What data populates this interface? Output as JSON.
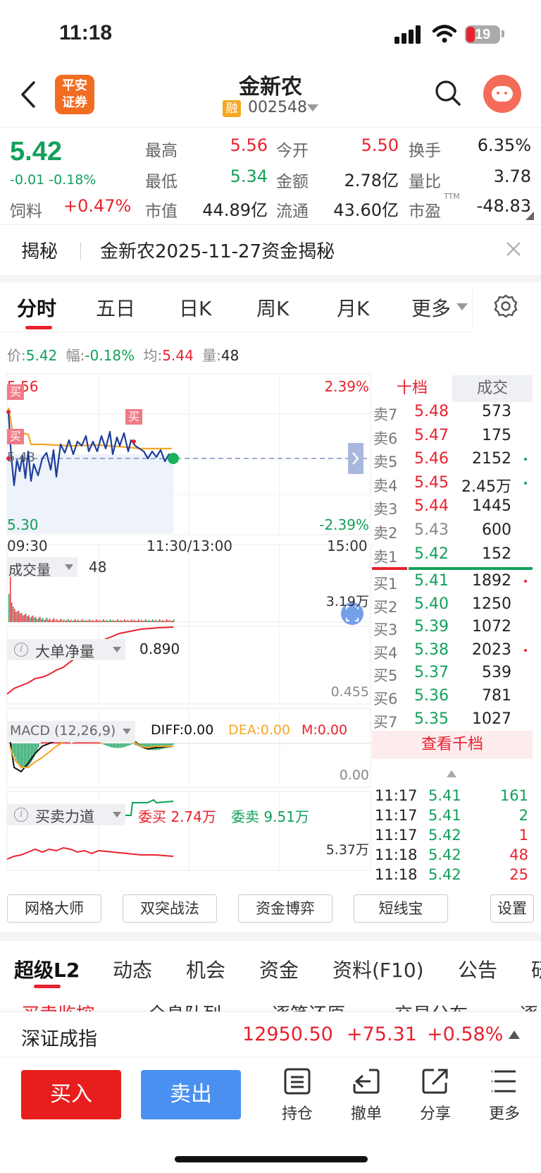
{
  "status_bar": {
    "time": "11:18",
    "battery": "19"
  },
  "header": {
    "title": "金新农",
    "code": "002548",
    "rong": "融",
    "broker_logo": [
      "平安",
      "证券"
    ]
  },
  "quote": {
    "price": "5.42",
    "change": "-0.01",
    "change_pct": "-0.18%",
    "sector": "饲料",
    "sector_pct": "+0.47%",
    "high_label": "最高",
    "high": "5.56",
    "low_label": "最低",
    "low": "5.34",
    "cap_label": "市值",
    "cap": "44.89亿",
    "open_label": "今开",
    "open": "5.50",
    "amount_label": "金额",
    "amount": "2.78亿",
    "float_label": "流通",
    "float": "43.60亿",
    "turnover_label": "换手",
    "turnover": "6.35%",
    "vol_ratio_label": "量比",
    "vol_ratio": "3.78",
    "pe_label": "市盈",
    "pe_sup": "TTM",
    "pe": "-48.83"
  },
  "banner": {
    "tag": "揭秘",
    "text": "金新农2025-11-27资金揭秘"
  },
  "chart_tabs": [
    "分时",
    "五日",
    "日K",
    "周K",
    "月K",
    "更多"
  ],
  "info_line": {
    "price_label": "价:",
    "price": "5.42",
    "amp_label": "幅:",
    "amp": "-0.18%",
    "avg_label": "均:",
    "avg": "5.44",
    "vol_label": "量:",
    "vol": "48"
  },
  "intraday": {
    "top_price": "5.56",
    "bottom_price": "5.30",
    "mid_price": "5.43",
    "top_pct": "2.39%",
    "bottom_pct": "-2.39%",
    "times": [
      "09:30",
      "11:30/13:00",
      "15:00"
    ],
    "buy_tag": "买"
  },
  "volume_panel": {
    "label": "成交量",
    "value": "48",
    "max": "3.19万"
  },
  "bigorder_panel": {
    "label": "大单净量",
    "value": "0.890",
    "mid": "0.455"
  },
  "macd_panel": {
    "label": "MACD (12,26,9)",
    "diff": "DIFF:0.00",
    "dea": "DEA:0.00",
    "m": "M:0.00",
    "zero": "0.00"
  },
  "force_panel": {
    "label": "买卖力道",
    "buy": "委买 2.74万",
    "sell": "委卖 9.51万",
    "level": "5.37万"
  },
  "orderbook": {
    "tab_active": "十档",
    "tab_other": "成交",
    "asks": [
      {
        "label": "卖7",
        "price": "5.48",
        "vol": "573"
      },
      {
        "label": "卖6",
        "price": "5.47",
        "vol": "175"
      },
      {
        "label": "卖5",
        "price": "5.46",
        "vol": "2152"
      },
      {
        "label": "卖4",
        "price": "5.45",
        "vol": "2.45万"
      },
      {
        "label": "卖3",
        "price": "5.44",
        "vol": "1445"
      },
      {
        "label": "卖2",
        "price": "5.43",
        "vol": "600"
      },
      {
        "label": "卖1",
        "price": "5.42",
        "vol": "152"
      }
    ],
    "bids": [
      {
        "label": "买1",
        "price": "5.41",
        "vol": "1892"
      },
      {
        "label": "买2",
        "price": "5.40",
        "vol": "1250"
      },
      {
        "label": "买3",
        "price": "5.39",
        "vol": "1072"
      },
      {
        "label": "买4",
        "price": "5.38",
        "vol": "2023"
      },
      {
        "label": "买5",
        "price": "5.37",
        "vol": "539"
      },
      {
        "label": "买6",
        "price": "5.36",
        "vol": "781"
      },
      {
        "label": "买7",
        "price": "5.35",
        "vol": "1027"
      }
    ],
    "view_more": "查看千档",
    "trades": [
      {
        "time": "11:17",
        "price": "5.41",
        "vol": "161"
      },
      {
        "time": "11:17",
        "price": "5.41",
        "vol": "2"
      },
      {
        "time": "11:17",
        "price": "5.42",
        "vol": "1"
      },
      {
        "time": "11:18",
        "price": "5.42",
        "vol": "48"
      },
      {
        "time": "11:18",
        "price": "5.42",
        "vol": "25"
      }
    ]
  },
  "tools": [
    "网格大师",
    "双突战法",
    "资金博弈",
    "短线宝",
    "设置"
  ],
  "bottom_tabs": [
    "超级L2",
    "动态",
    "机会",
    "资金",
    "资料(F10)",
    "公告",
    "研"
  ],
  "sub_tabs": [
    "买卖监控",
    "全息队列",
    "逐笔还原",
    "交易分布",
    "逐"
  ],
  "index_bar": {
    "name": "深证成指",
    "value": "12950.50",
    "change": "+75.31",
    "pct": "+0.58%"
  },
  "action_bar": {
    "buy": "买入",
    "sell": "卖出",
    "hold": "持仓",
    "cancel": "撤单",
    "share": "分享",
    "more": "更多"
  },
  "colors": {
    "red": "#e8222e",
    "green": "#12a05a",
    "blue": "#4a90f0",
    "brand": "#f26c21"
  }
}
